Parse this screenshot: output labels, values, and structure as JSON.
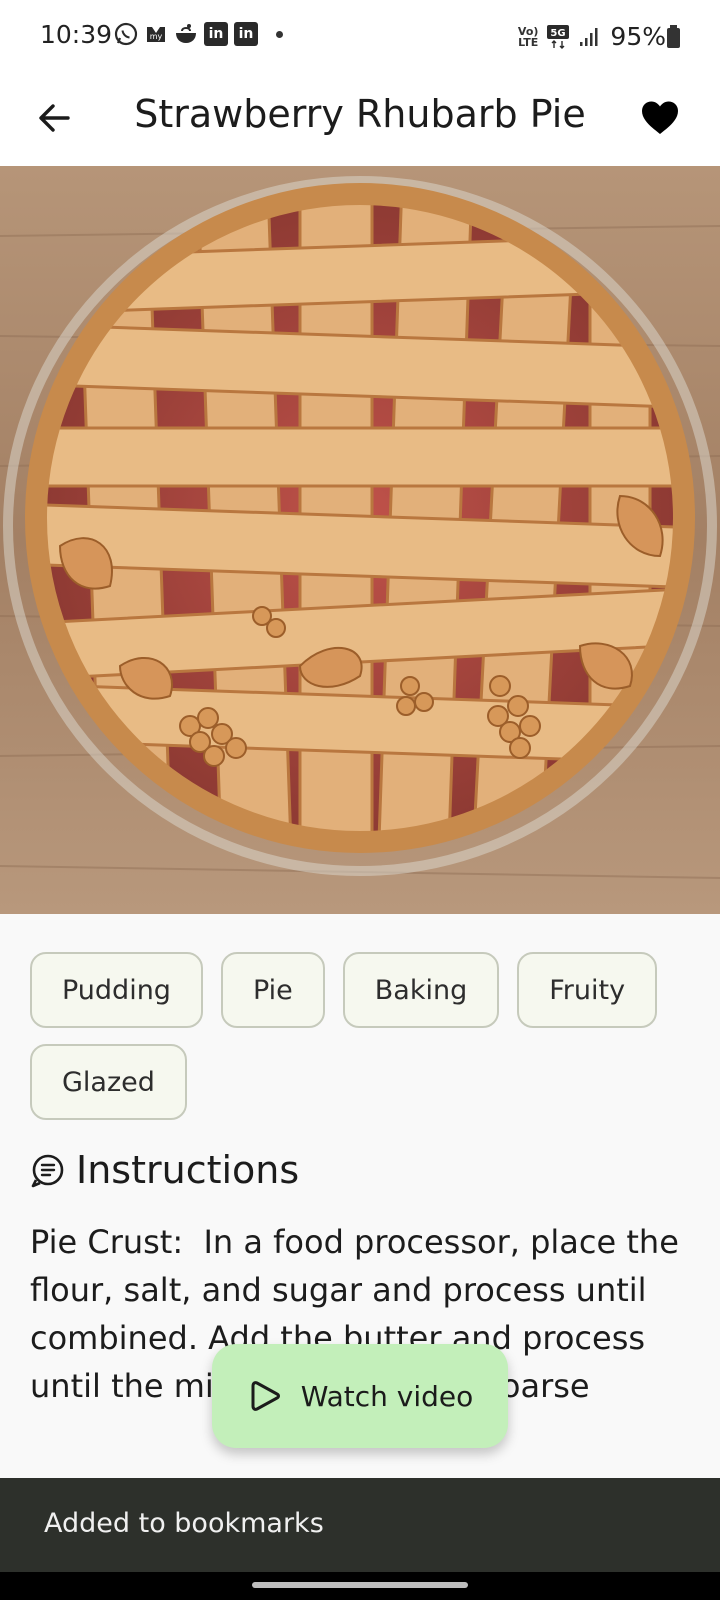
{
  "status_bar": {
    "time": "10:39",
    "battery": "95%",
    "network": "5G",
    "volte": "Vo) LTE",
    "notification_icons": [
      "whatsapp-icon",
      "myntra-icon",
      "swiggy-icon",
      "linkedin-icon",
      "linkedin-icon"
    ]
  },
  "app_bar": {
    "title": "Strawberry Rhubarb Pie",
    "back_icon": "arrow-left-icon",
    "favorite_icon": "heart-filled-icon"
  },
  "hero_image": {
    "alt": "Strawberry Rhubarb Pie"
  },
  "tags": [
    "Pudding",
    "Pie",
    "Baking",
    "Fruity",
    "Glazed"
  ],
  "instructions": {
    "heading": "Instructions",
    "icon": "chef-hat-icon",
    "text": "Pie Crust:  In a food processor, place the flour, salt, and sugar and process until combined. Add the butter and process until the mixture resembles coarse"
  },
  "fab": {
    "label": "Watch video",
    "icon": "play-circle-icon"
  },
  "snackbar": {
    "message": "Added to bookmarks"
  },
  "colors": {
    "chip_bg": "#f6f8ef",
    "chip_border": "#c6cabc",
    "fab_bg": "#c3efba",
    "snackbar_bg": "#2d302b",
    "page_bg": "#f9f9f9"
  }
}
